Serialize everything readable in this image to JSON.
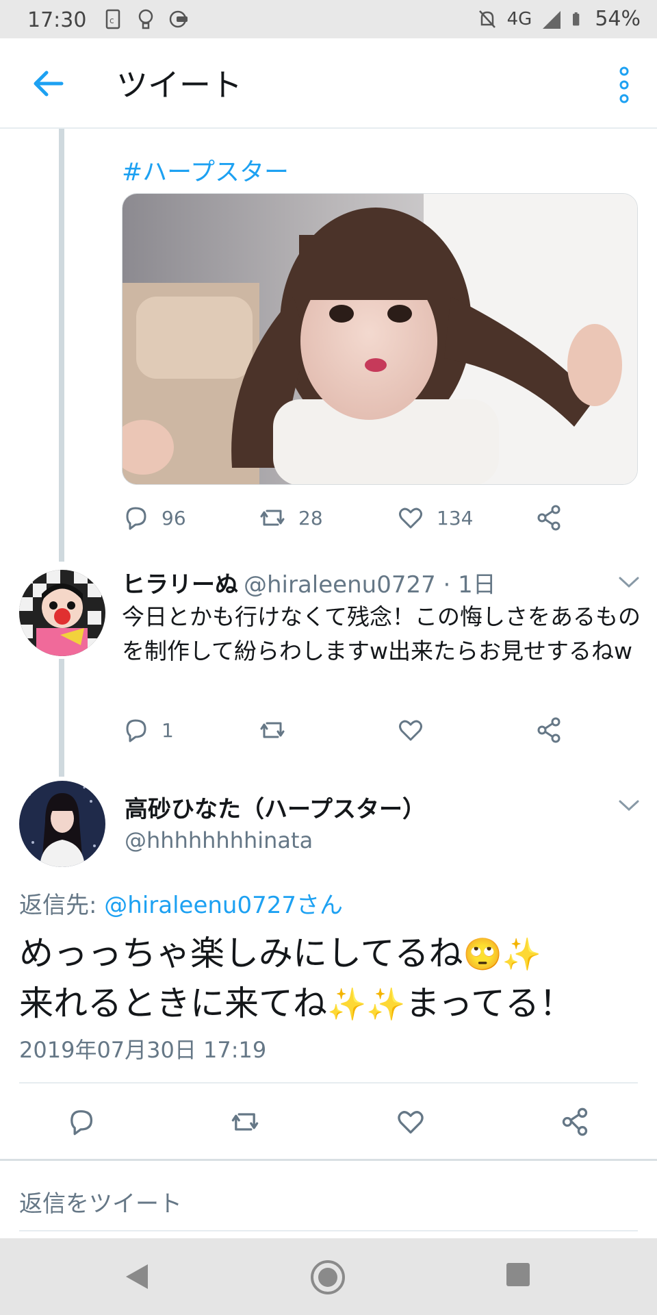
{
  "status_bar": {
    "time": "17:30",
    "network": "4G",
    "battery": "54%"
  },
  "app_bar": {
    "title": "ツイート"
  },
  "parent_tweet": {
    "hashtag": "#ハープスター",
    "counts": {
      "reply": "96",
      "retweet": "28",
      "like": "134"
    }
  },
  "reply_tweet": {
    "name": "ヒラリーぬ",
    "handle_time": "@hiraleenu0727 · 1日",
    "text": "今日とかも行けなくて残念！この悔しさをあるものを制作して紛らわしますw出来たらお見せするねw",
    "counts": {
      "reply": "1"
    }
  },
  "main_tweet": {
    "name": "高砂ひなた（ハープスター）",
    "handle": "@hhhhhhhhinata",
    "replying_label": "返信先:",
    "replying_to": "@hiraleenu0727さん",
    "line1": "めっっちゃ楽しみにしてるね",
    "line2": "来れるときに来てね",
    "line2_end": "まってる！",
    "emoji_face": "🙄",
    "emoji_sparkle": "✨",
    "timestamp": "2019年07月30日 17:19"
  },
  "compose": {
    "placeholder": "返信をツイート"
  },
  "colors": {
    "accent": "#1da1f2",
    "secondary_text": "#657786"
  }
}
